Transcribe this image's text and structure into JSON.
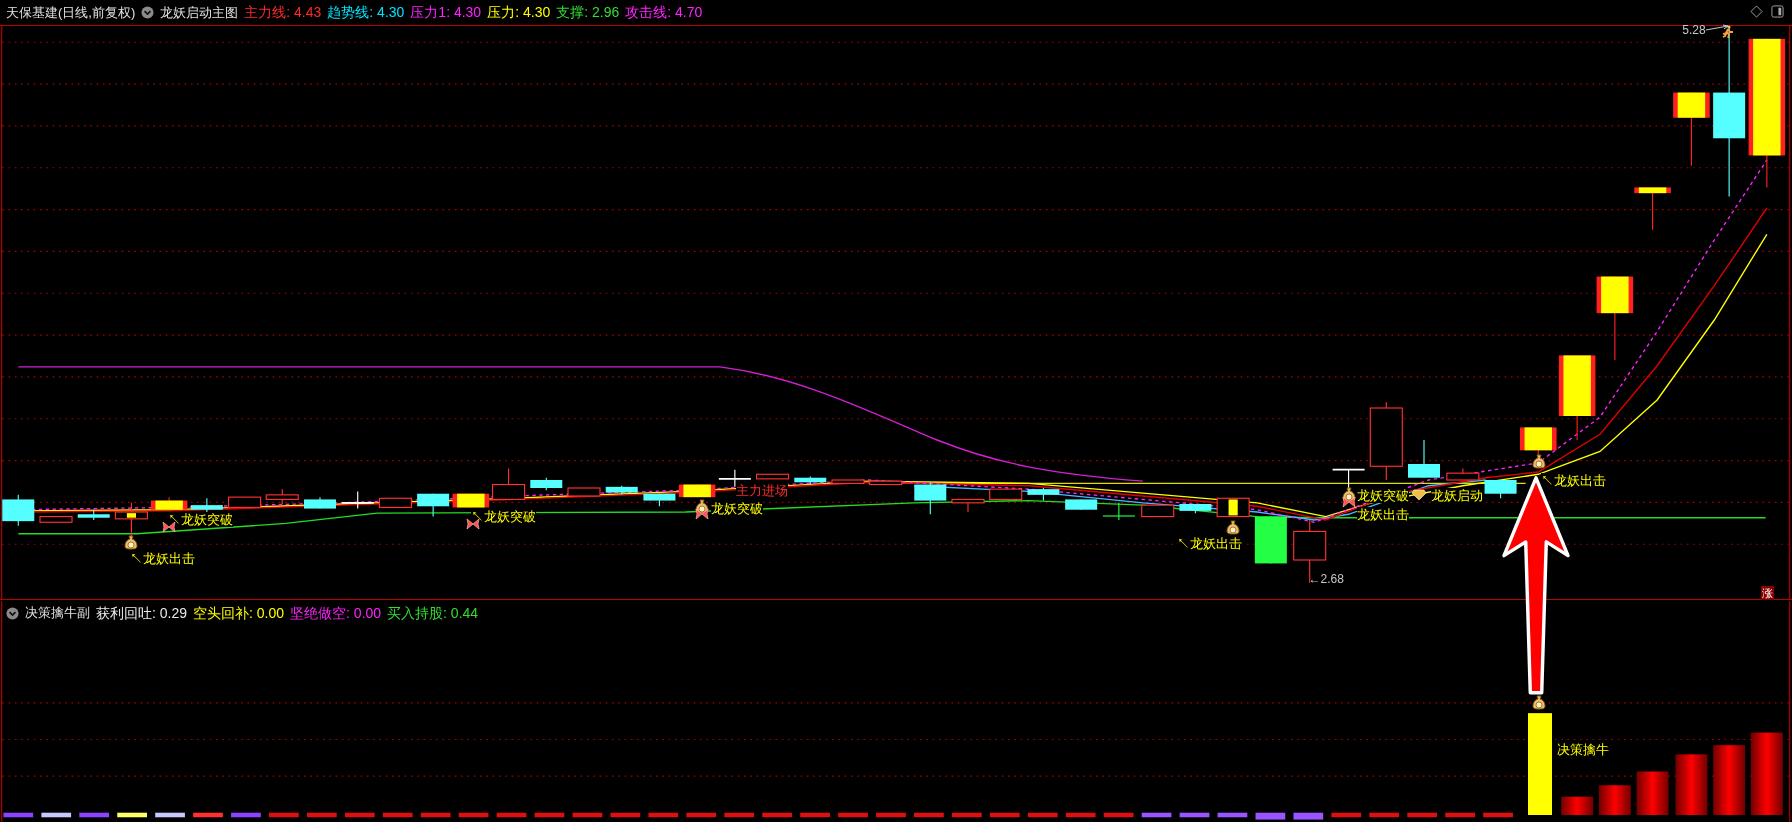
{
  "main_panel": {
    "title": "天保基建(日线,前复权)",
    "indicator": "龙妖启动主图",
    "values": [
      {
        "label": "主力线:",
        "value": "4.43",
        "color": "#ff2a2a"
      },
      {
        "label": "趋势线:",
        "value": "4.30",
        "color": "#00e5ff"
      },
      {
        "label": "压力1:",
        "value": "4.30",
        "color": "#ff22ff"
      },
      {
        "label": "压力:",
        "value": "4.30",
        "color": "#ffff00"
      },
      {
        "label": "支撑:",
        "value": "2.96",
        "color": "#33dd33"
      },
      {
        "label": "攻击线:",
        "value": "4.70",
        "color": "#ff22ff"
      }
    ],
    "price_labels": [
      {
        "text": "5.28"
      },
      {
        "text": "←2.68"
      }
    ],
    "annotations": [
      {
        "text": "↖龙妖出击",
        "color": "#ffff00"
      },
      {
        "text": "↖龙妖突破",
        "color": "#ffff00"
      },
      {
        "text": "↖龙妖突破",
        "color": "#ffff00"
      },
      {
        "text": "主力进场",
        "color": "#ff2a2a"
      },
      {
        "text": "龙妖突破",
        "color": "#ffff00"
      },
      {
        "text": "↖龙妖出击",
        "color": "#ffff00"
      },
      {
        "text": "龙妖突破",
        "color": "#ffff00"
      },
      {
        "text": "龙妖启动",
        "color": "#ffff00"
      },
      {
        "text": "龙妖出击",
        "color": "#ffff00"
      },
      {
        "text": "↖龙妖出击",
        "color": "#ffff00"
      }
    ],
    "badge": "涨"
  },
  "sub_panel": {
    "indicator": "决策擒牛副",
    "values": [
      {
        "label": "获利回吐:",
        "value": "0.29",
        "color": "#e8e8e8"
      },
      {
        "label": "空头回补:",
        "value": "0.00",
        "color": "#ffff00"
      },
      {
        "label": "坚绝做空:",
        "value": "0.00",
        "color": "#ff22ff"
      },
      {
        "label": "买入持股:",
        "value": "0.44",
        "color": "#33dd33"
      }
    ],
    "annotations": [
      {
        "text": "决策擒牛",
        "color": "#ffff00"
      }
    ]
  }
}
